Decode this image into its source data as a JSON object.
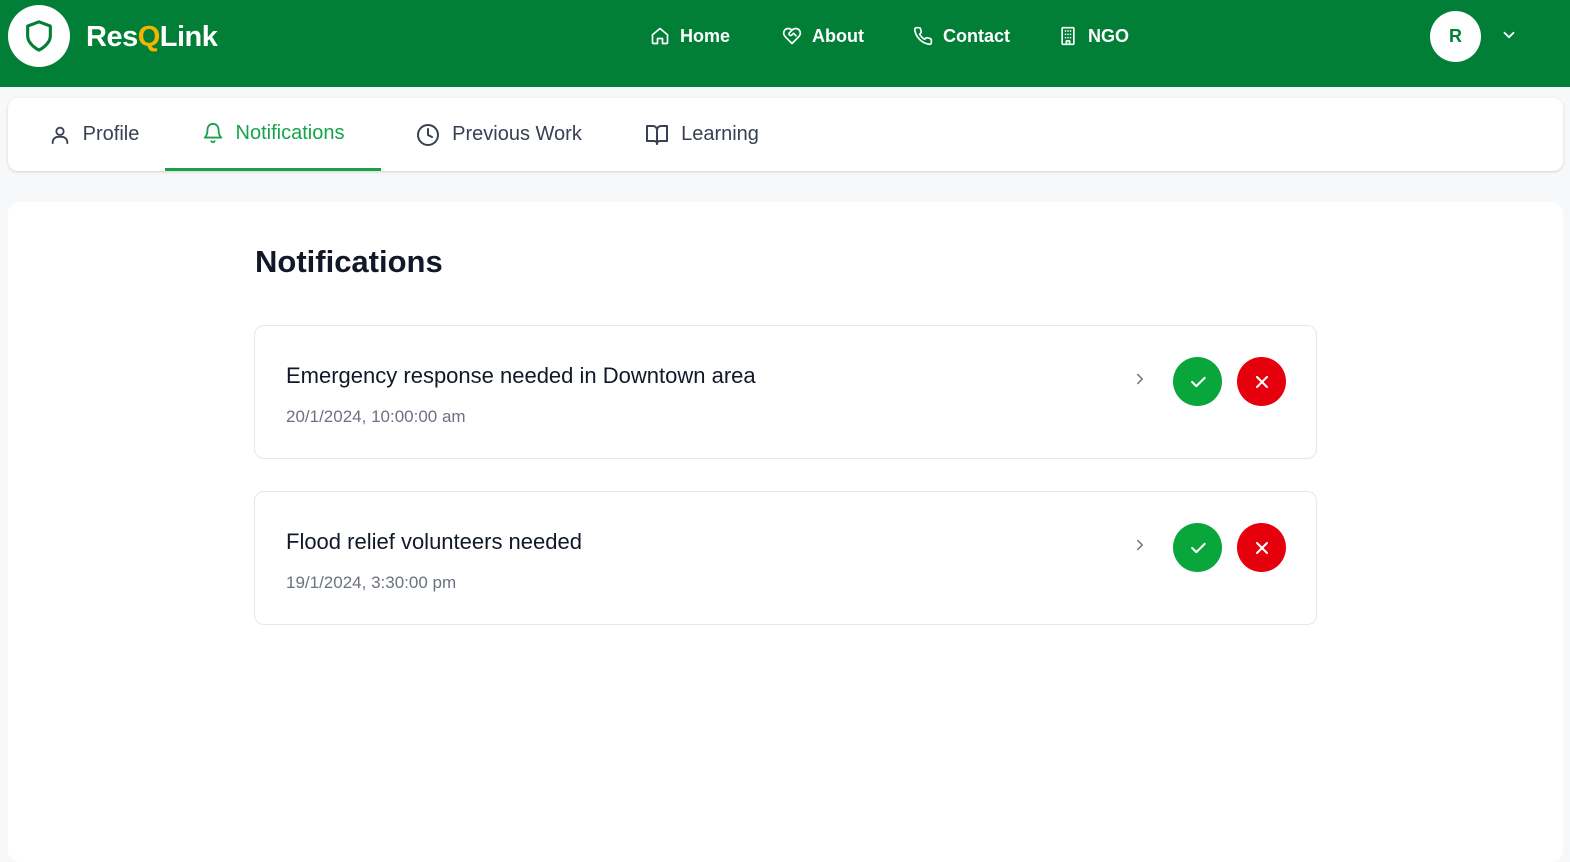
{
  "brand": {
    "name_part1": "Res",
    "name_q": "Q",
    "name_part2": "Link"
  },
  "nav": {
    "home": "Home",
    "about": "About",
    "contact": "Contact",
    "ngo": "NGO"
  },
  "user": {
    "avatar_initial": "R"
  },
  "tabs": [
    {
      "label": "Profile",
      "icon": "user-icon",
      "active": false
    },
    {
      "label": "Notifications",
      "icon": "bell-icon",
      "active": true
    },
    {
      "label": "Previous Work",
      "icon": "clock-icon",
      "active": false
    },
    {
      "label": "Learning",
      "icon": "book-open-icon",
      "active": false
    }
  ],
  "main": {
    "title": "Notifications",
    "notifications": [
      {
        "title": "Emergency response needed in Downtown area",
        "time": "20/1/2024, 10:00:00 am"
      },
      {
        "title": "Flood relief volunteers needed",
        "time": "19/1/2024, 3:30:00 pm"
      }
    ]
  },
  "colors": {
    "header_bg": "#017f36",
    "brand_accent": "#f5b400",
    "active_tab": "#16a34a",
    "accept": "#08a63b",
    "reject": "#e5000c"
  }
}
